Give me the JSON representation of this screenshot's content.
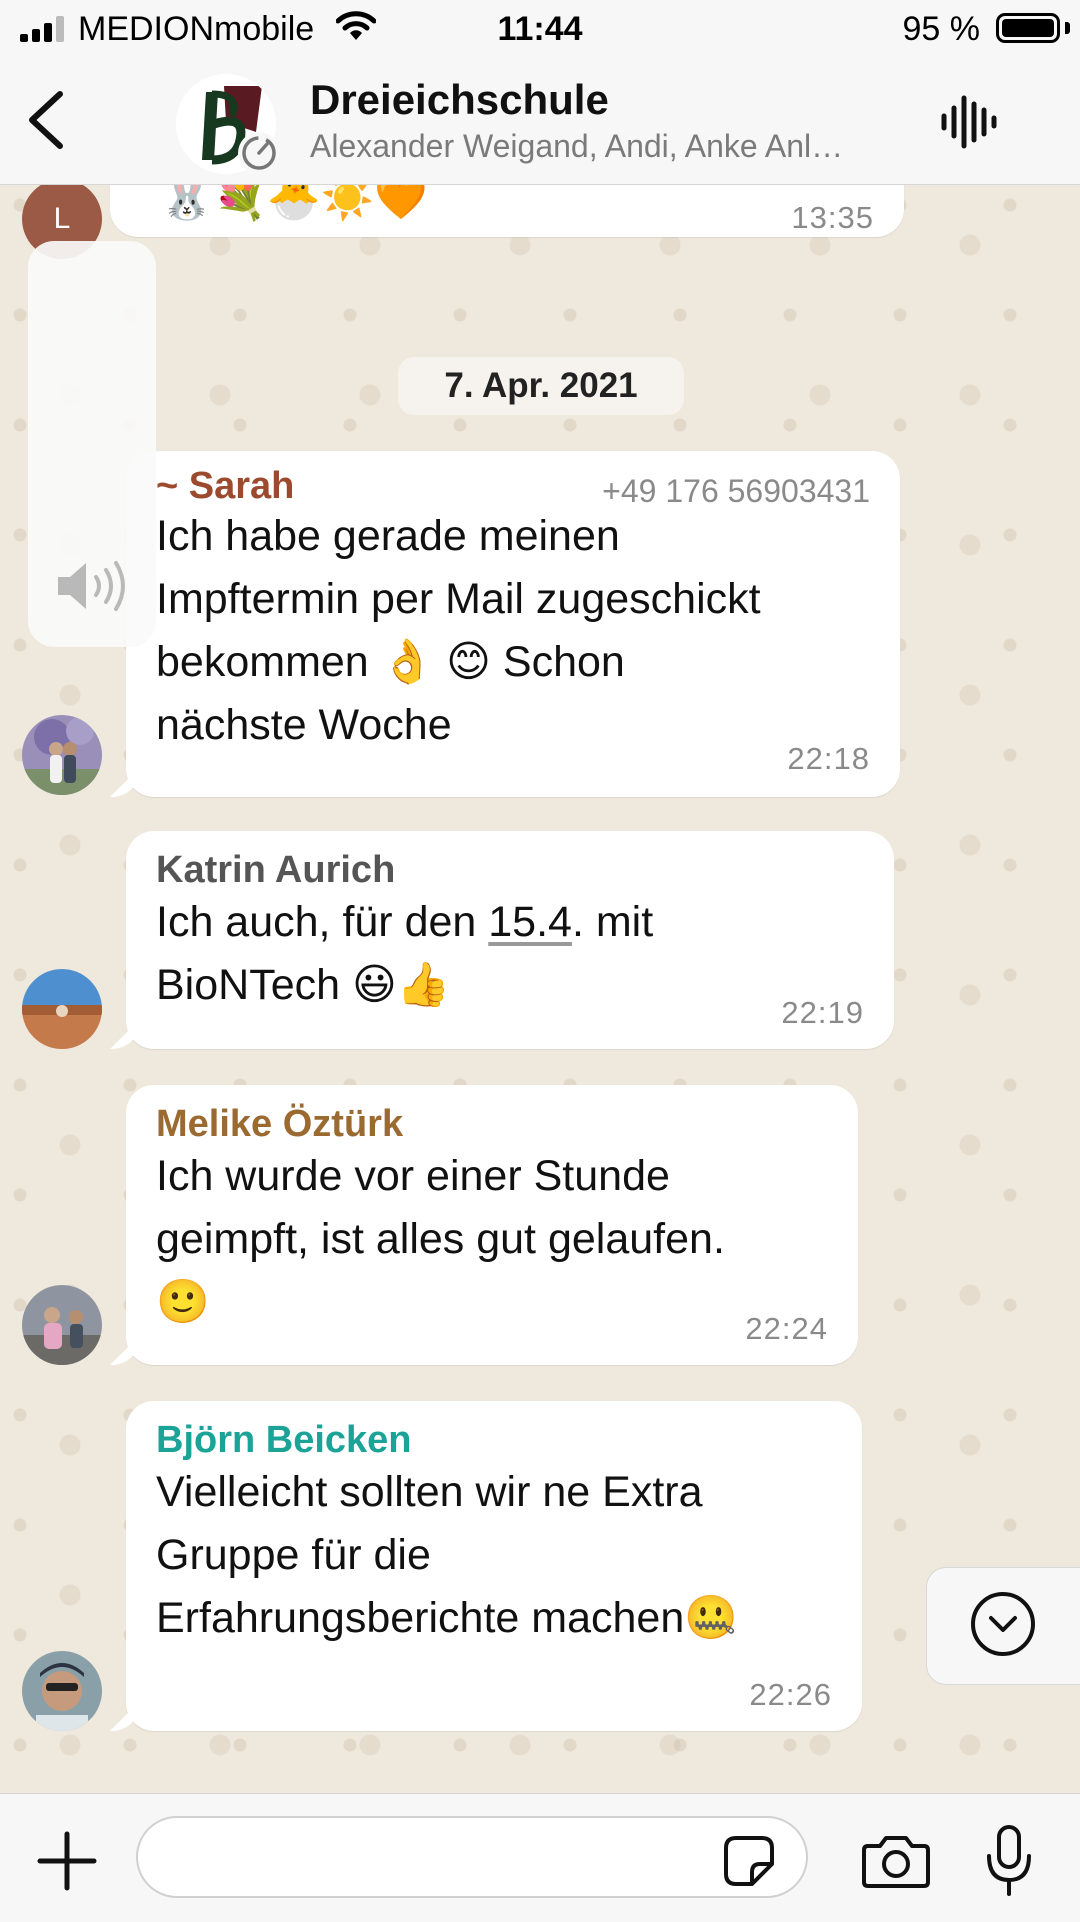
{
  "status_bar": {
    "carrier": "MEDIONmobile",
    "time": "11:44",
    "battery_percent": "95 %"
  },
  "header": {
    "title": "Dreieichschule",
    "members": "Alexander Weigand, Andi, Anke Anl…",
    "icons": [
      "chevron-left-icon",
      "disappearing-timer-icon",
      "voice-chat-icon"
    ]
  },
  "chat": {
    "previous_message": {
      "avatar_letter": "L",
      "emojis": "🐰💐🐣☀️🧡",
      "time": "13:35"
    },
    "date_separator": "7. Apr. 2021",
    "messages": [
      {
        "sender": "~ Sarah",
        "sender_color": "#9c4a2e",
        "phone": "+49 176 56903431",
        "lines": [
          "Ich habe gerade meinen",
          "Impftermin per Mail zugeschickt",
          "bekommen 👌 😊 Schon",
          "nächste Woche"
        ],
        "time": "22:18"
      },
      {
        "sender": "Katrin Aurich",
        "sender_color": "#555555",
        "line1_prefix": "Ich auch, für den ",
        "line1_date": "15.4",
        "line1_suffix": ". mit",
        "line2": "BioNTech 😃👍",
        "time": "22:19"
      },
      {
        "sender": "Melike Öztürk",
        "sender_color": "#9a6a30",
        "lines": [
          "Ich wurde vor einer Stunde",
          "geimpft, ist alles gut gelaufen.",
          "🙂"
        ],
        "time": "22:24"
      },
      {
        "sender": "Björn Beicken",
        "sender_color": "#1aa396",
        "lines": [
          "Vielleicht sollten wir ne Extra",
          "Gruppe für die",
          "Erfahrungsberichte machen🤐"
        ],
        "time": "22:26"
      }
    ]
  },
  "composer": {
    "input_value": "",
    "icons": [
      "plus-icon",
      "sticker-icon",
      "camera-icon",
      "microphone-icon"
    ]
  },
  "colors": {
    "chat_background": "#efe8dc",
    "bubble": "#ffffff",
    "bars": "#f7f7f7"
  }
}
